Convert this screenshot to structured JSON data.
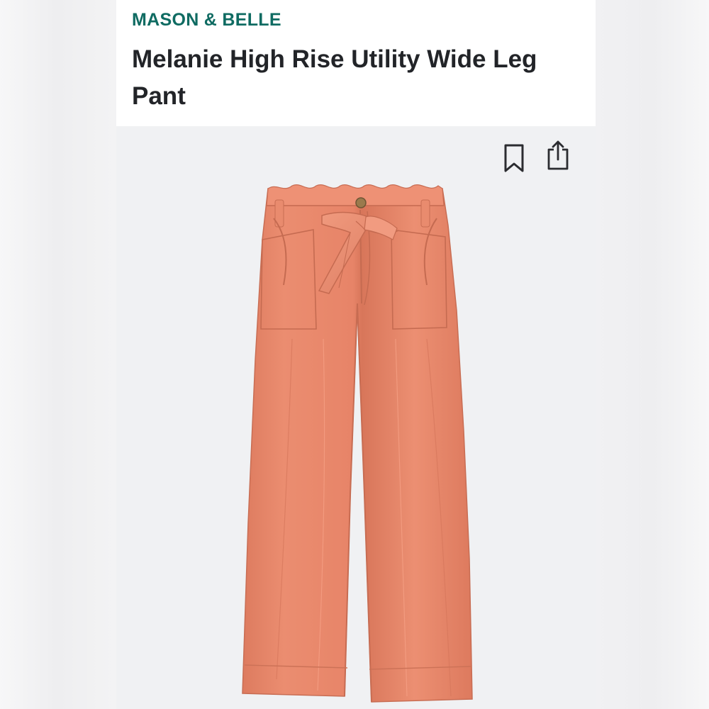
{
  "product": {
    "brand": "MASON & BELLE",
    "title": "Melanie High Rise Utility Wide Leg Pant",
    "image": {
      "subject": "coral wide leg pant with tie belt",
      "color": "#e98b6e"
    }
  },
  "actions": {
    "bookmark_icon": "bookmark-icon",
    "share_icon": "share-icon"
  },
  "colors": {
    "brand": "#0f6b62",
    "title": "#222428",
    "card_background": "#f0f1f3",
    "header_background": "#ffffff"
  }
}
